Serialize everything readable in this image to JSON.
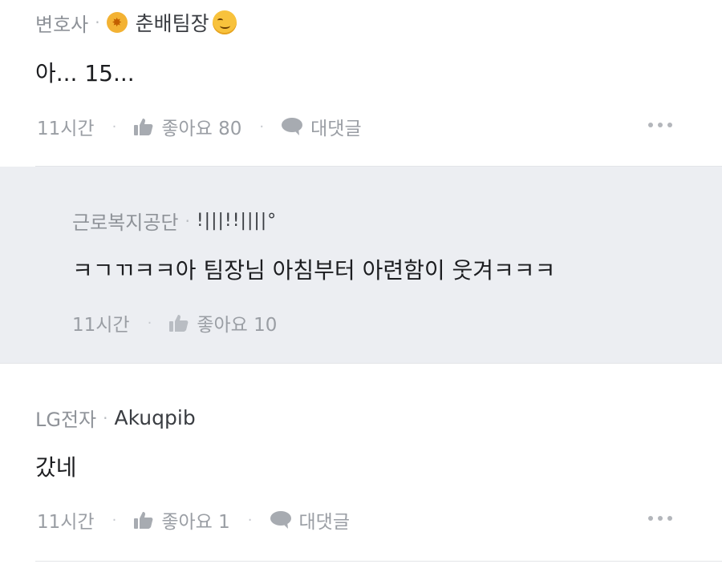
{
  "comments": [
    {
      "company": "변호사",
      "nickname": "춘배팀장",
      "text": "아... 15...",
      "time": "11시간",
      "like_label": "좋아요 80",
      "reply_label": "대댓글"
    },
    {
      "company": "근로복지공단",
      "nickname": "!|||!!||||°",
      "text": "ㅋㄱㄲㅋㅋ아 팀장님 아침부터 아련함이 웃겨ㅋㅋㅋ",
      "time": "11시간",
      "like_label": "좋아요 10"
    },
    {
      "company": "LG전자",
      "nickname": "Akuqpib",
      "text": "갔네",
      "time": "11시간",
      "like_label": "좋아요 1",
      "reply_label": "대댓글"
    }
  ],
  "separator_dot": "·",
  "icons": [
    "badge-icon",
    "smirk-emoji-icon",
    "thumbs-up-icon",
    "speech-bubble-icon",
    "more-icon"
  ],
  "colors": {
    "reply_background": "#eceef2",
    "meta_gray": "#9a9ea4",
    "badge": "#f3b233"
  }
}
